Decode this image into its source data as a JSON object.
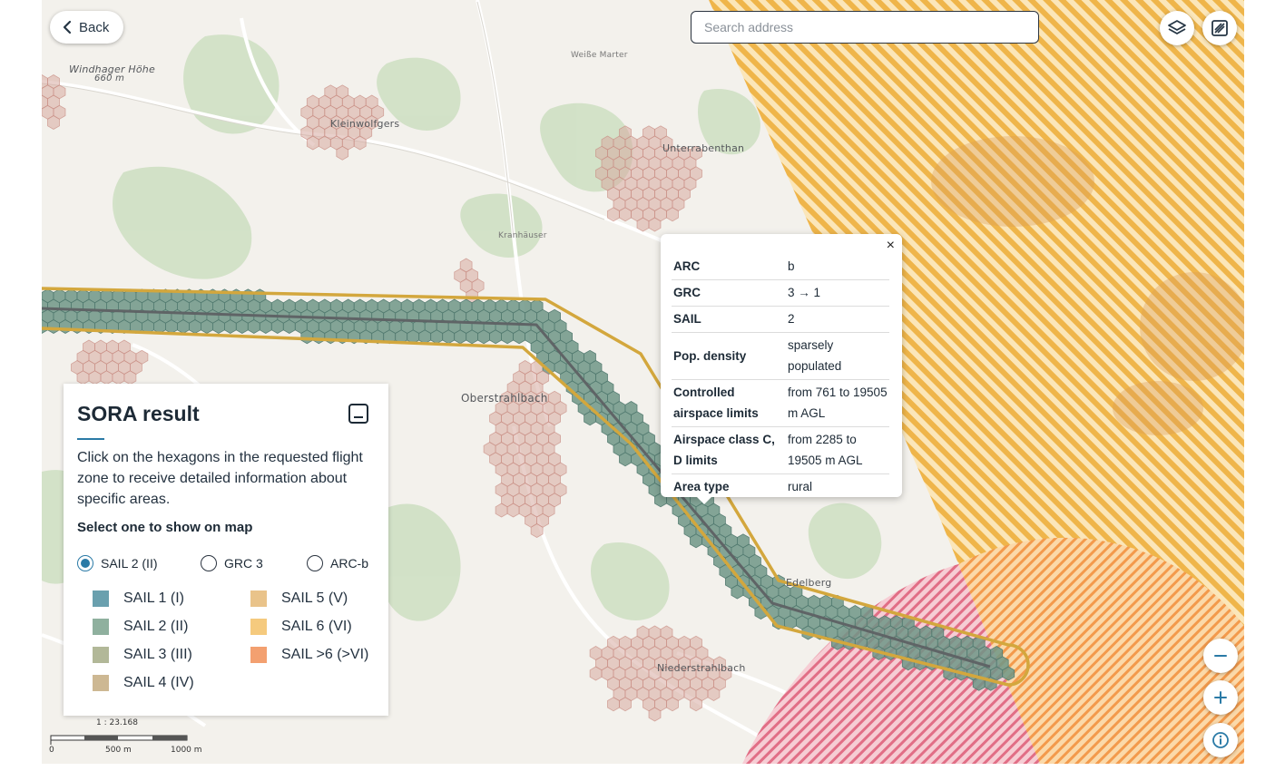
{
  "header": {
    "back_label": "Back"
  },
  "search": {
    "placeholder": "Search address"
  },
  "icons": {
    "back": "chevron-left-icon",
    "layers": "layers-icon",
    "draw": "draw-area-icon",
    "zoom_out": "minus-icon",
    "zoom_in": "plus-icon",
    "info": "info-icon",
    "close": "close-icon"
  },
  "map_labels": {
    "windhager": "Windhager Höhe",
    "windhager_elev": "660 m",
    "kleinwolfgers": "Kleinwolfgers",
    "unterrabenthan": "Unterrabenthan",
    "oberstrahlbach": "Oberstrahlbach",
    "niederstrahlbach": "Niederstrahlbach",
    "edelberg": "Edelberg",
    "weisse_marter": "Weiße Marter",
    "kranhauser": "Kranhäuser"
  },
  "popup": {
    "close": "×",
    "rows": [
      {
        "key": "ARC",
        "value": "b"
      },
      {
        "key": "GRC",
        "value": "3 → 1"
      },
      {
        "key": "SAIL",
        "value": "2"
      },
      {
        "key": "Pop. density",
        "value": "sparsely populated"
      },
      {
        "key": "Controlled airspace limits",
        "value": "from 761 to 19505 m AGL"
      },
      {
        "key": "Airspace class C, D limits",
        "value": "from 2285 to 19505 m AGL"
      },
      {
        "key": "Area type",
        "value": "rural"
      }
    ]
  },
  "panel": {
    "title": "SORA result",
    "description": "Click on the hexagons in the requested flight zone to receive detailed information about specific areas.",
    "select_title": "Select one to show on map",
    "options": [
      {
        "label": "SAIL 2 (II)",
        "selected": true
      },
      {
        "label": "GRC 3",
        "selected": false
      },
      {
        "label": "ARC-b",
        "selected": false
      }
    ],
    "legend": [
      {
        "label": "SAIL 1 (I)",
        "color": "#6aa0ae"
      },
      {
        "label": "SAIL 2 (II)",
        "color": "#8fb09e"
      },
      {
        "label": "SAIL 3 (III)",
        "color": "#b2b898"
      },
      {
        "label": "SAIL 4 (IV)",
        "color": "#cdb893"
      },
      {
        "label": "SAIL 5 (V)",
        "color": "#e9c38a"
      },
      {
        "label": "SAIL 6 (VI)",
        "color": "#f5ca7e"
      },
      {
        "label": "SAIL >6 (>VI)",
        "color": "#f3a070"
      }
    ]
  },
  "scale": {
    "ratio": "1 : 23.168",
    "zero": "0",
    "mid": "500 m",
    "end": "1000 m"
  },
  "colors": {
    "accent": "#2a7aa6",
    "route": "#d3a73d",
    "hex_fill": "#7fa596",
    "orange_zone": "#f0b94a",
    "pink_zone": "#e48a9b"
  }
}
